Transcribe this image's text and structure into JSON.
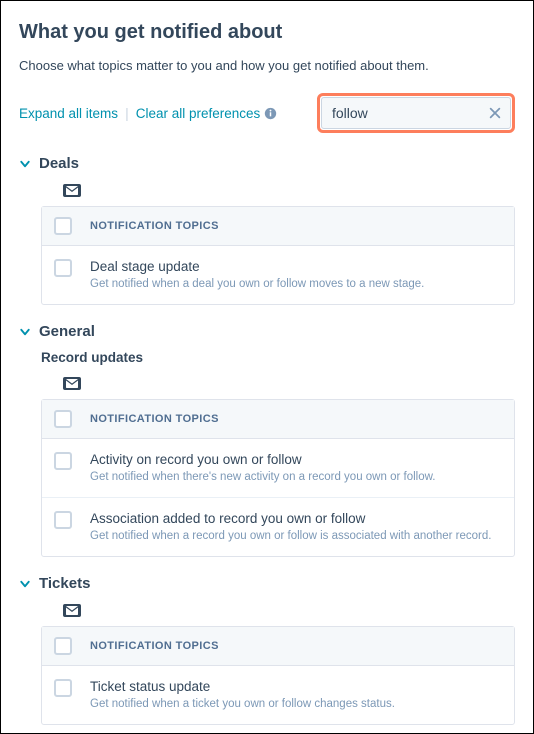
{
  "header": {
    "title": "What you get notified about",
    "subtitle": "Choose what topics matter to you and how you get notified about them."
  },
  "controls": {
    "expand_label": "Expand all items",
    "clear_label": "Clear all preferences"
  },
  "search": {
    "value": "follow"
  },
  "column_header": "NOTIFICATION TOPICS",
  "sections": [
    {
      "title": "Deals",
      "subsections": [
        {
          "title": "",
          "items": [
            {
              "title": "Deal stage update",
              "desc": "Get notified when a deal you own or follow moves to a new stage."
            }
          ]
        }
      ]
    },
    {
      "title": "General",
      "subsections": [
        {
          "title": "Record updates",
          "items": [
            {
              "title": "Activity on record you own or follow",
              "desc": "Get notified when there's new activity on a record you own or follow."
            },
            {
              "title": "Association added to record you own or follow",
              "desc": "Get notified when a record you own or follow is associated with another record."
            }
          ]
        }
      ]
    },
    {
      "title": "Tickets",
      "subsections": [
        {
          "title": "",
          "items": [
            {
              "title": "Ticket status update",
              "desc": "Get notified when a ticket you own or follow changes status."
            }
          ]
        }
      ]
    }
  ]
}
